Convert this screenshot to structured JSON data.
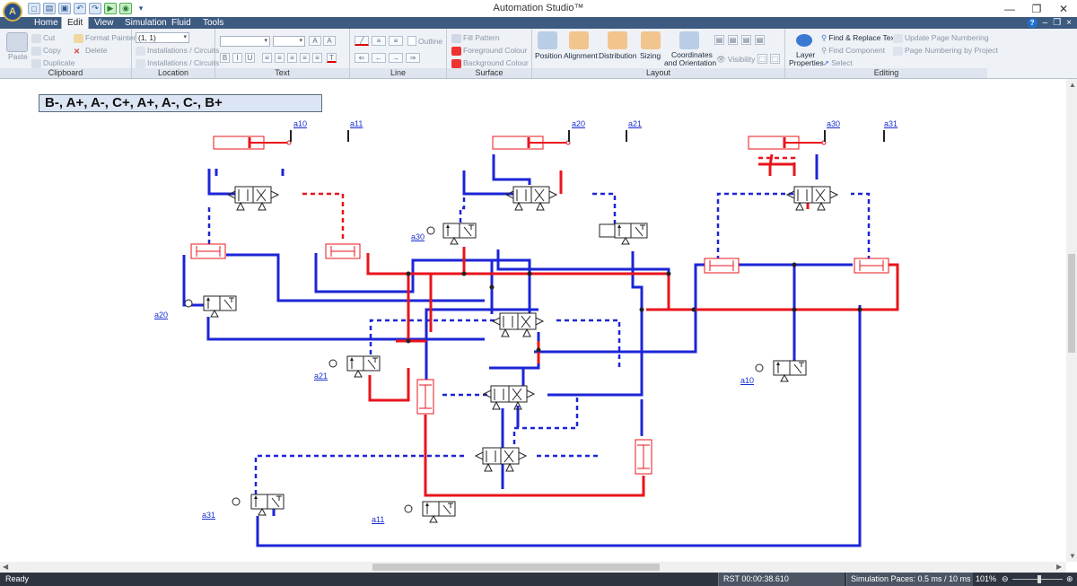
{
  "app": {
    "title": "Automation Studio™",
    "logo": "Automation Studio logo",
    "controls": {
      "minimize": "—",
      "restore": "❐",
      "close": "✕"
    }
  },
  "tabs": {
    "home": "Home",
    "edit": "Edit",
    "view": "View",
    "simulation": "Simulation",
    "fluid": "Fluid",
    "tools": "Tools"
  },
  "ribbon": {
    "clipboard": {
      "label": "Clipboard",
      "paste": "Paste",
      "cut": "Cut",
      "copy": "Copy",
      "duplicate": "Duplicate",
      "format_painter": "Format Painter",
      "delete": "Delete"
    },
    "location": {
      "label": "Location",
      "coords_value": "(1, 1)",
      "installations_circuits_1": "Installations / Circuits",
      "installations_circuits_2": "Installations / Circuits"
    },
    "text": {
      "label": "Text",
      "bold": "B",
      "italic": "I",
      "underline": "U"
    },
    "line": {
      "label": "Line",
      "outline": "Outline"
    },
    "surface": {
      "label": "Surface",
      "fill_pattern": "Fill Pattern",
      "foreground_colour": "Foreground Colour",
      "background_colour": "Background Colour"
    },
    "layout": {
      "label": "Layout",
      "position": "Position",
      "alignment": "Alignment",
      "distribution": "Distribution",
      "sizing": "Sizing",
      "coordinates_line1": "Coordinates",
      "coordinates_line2": "and Orientation",
      "visibility": "Visibility"
    },
    "editing": {
      "label": "Editing",
      "layer_properties_line1": "Layer",
      "layer_properties_line2": "Properties",
      "find_replace": "Find & Replace Text",
      "find_component": "Find Component",
      "select": "Select",
      "update_page_numbering": "Update Page Numbering",
      "page_numbering_by_project": "Page Numbering by Project"
    }
  },
  "canvas": {
    "sequence": "B-, A+, A-, C+, A+, A-, C-, B+",
    "labels": {
      "a10_top": "a10",
      "a11_top": "a11",
      "a20_top": "a20",
      "a21_top": "a21",
      "a30_top": "a30",
      "a31_top": "a31",
      "a30_mid": "a30",
      "a20_left": "a20",
      "a21_mid": "a21",
      "a10_right": "a10",
      "a31_bottom": "a31",
      "a11_bottom": "a11"
    }
  },
  "status": {
    "ready": "Ready",
    "rst": "RST 00:00:38.610",
    "simulation_paces": "Simulation Paces: 0.5 ms / 10 ms",
    "zoom": "101%"
  },
  "colors": {
    "pressure_line": "#e8141c",
    "return_line": "#1c25d6",
    "ribbon_tab_bar": "#3d5a80",
    "status_bar": "#2f3540"
  }
}
